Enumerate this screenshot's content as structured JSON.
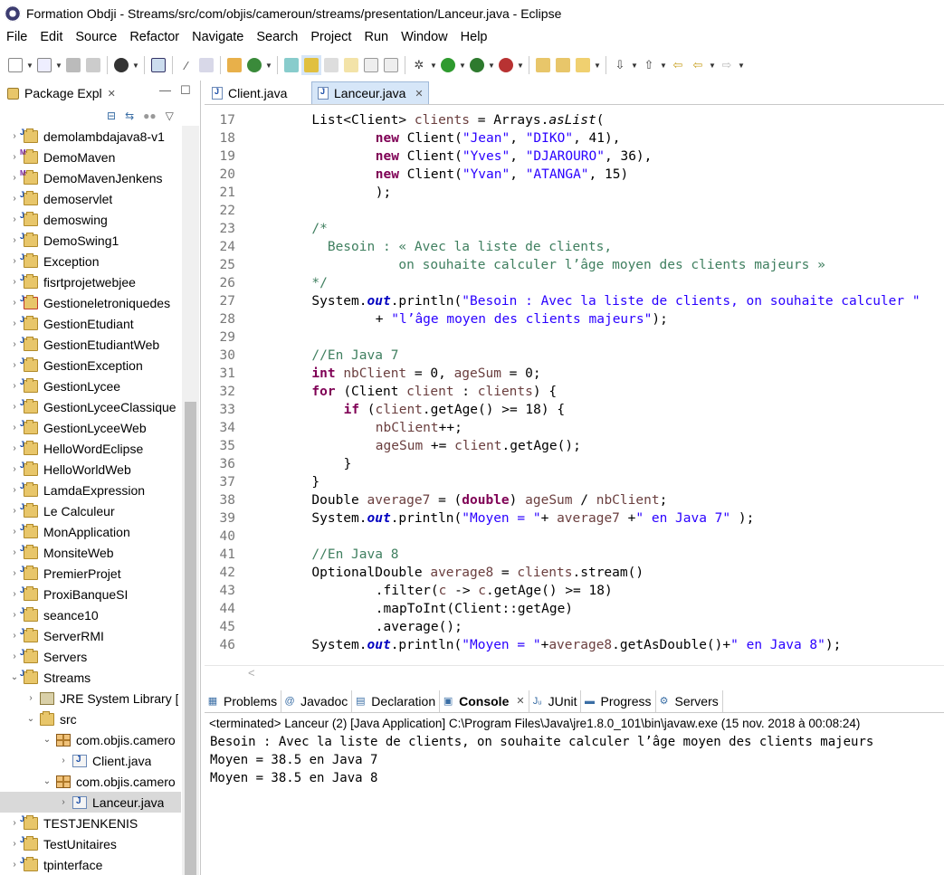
{
  "window": {
    "title": "Formation Obdji - Streams/src/com/objis/cameroun/streams/presentation/Lanceur.java - Eclipse"
  },
  "menu": [
    "File",
    "Edit",
    "Source",
    "Refactor",
    "Navigate",
    "Search",
    "Project",
    "Run",
    "Window",
    "Help"
  ],
  "toolbar_icons": [
    "new-icon",
    "save-icon",
    "print-icon",
    "debug-icon",
    "run-icon",
    "external-tools-icon",
    "search-icon",
    "back-icon",
    "forward-icon"
  ],
  "explorer": {
    "tab_label": "Package Expl",
    "items": [
      {
        "label": "demolambdajava8-v1",
        "twisty": ">",
        "icon": "project"
      },
      {
        "label": "DemoMaven",
        "twisty": ">",
        "icon": "maven"
      },
      {
        "label": "DemoMavenJenkens",
        "twisty": ">",
        "icon": "maven"
      },
      {
        "label": "demoservlet",
        "twisty": ">",
        "icon": "project"
      },
      {
        "label": "demoswing",
        "twisty": ">",
        "icon": "project"
      },
      {
        "label": "DemoSwing1",
        "twisty": ">",
        "icon": "project"
      },
      {
        "label": "Exception",
        "twisty": ">",
        "icon": "project"
      },
      {
        "label": "fisrtprojetwebjee",
        "twisty": ">",
        "icon": "project"
      },
      {
        "label": "Gestioneletroniquedes",
        "twisty": ">",
        "icon": "error"
      },
      {
        "label": "GestionEtudiant",
        "twisty": ">",
        "icon": "project"
      },
      {
        "label": "GestionEtudiantWeb",
        "twisty": ">",
        "icon": "project"
      },
      {
        "label": "GestionException",
        "twisty": ">",
        "icon": "project"
      },
      {
        "label": "GestionLycee",
        "twisty": ">",
        "icon": "project"
      },
      {
        "label": "GestionLyceeClassique",
        "twisty": ">",
        "icon": "project"
      },
      {
        "label": "GestionLyceeWeb",
        "twisty": ">",
        "icon": "project"
      },
      {
        "label": "HelloWordEclipse",
        "twisty": ">",
        "icon": "project"
      },
      {
        "label": "HelloWorldWeb",
        "twisty": ">",
        "icon": "project"
      },
      {
        "label": "LamdaExpression",
        "twisty": ">",
        "icon": "project"
      },
      {
        "label": "Le Calculeur",
        "twisty": ">",
        "icon": "project"
      },
      {
        "label": "MonApplication",
        "twisty": ">",
        "icon": "project"
      },
      {
        "label": "MonsiteWeb",
        "twisty": ">",
        "icon": "project"
      },
      {
        "label": "PremierProjet",
        "twisty": ">",
        "icon": "project"
      },
      {
        "label": "ProxiBanqueSI",
        "twisty": ">",
        "icon": "project"
      },
      {
        "label": "seance10",
        "twisty": ">",
        "icon": "project"
      },
      {
        "label": "ServerRMI",
        "twisty": ">",
        "icon": "project"
      },
      {
        "label": "Servers",
        "twisty": ">",
        "icon": "project"
      },
      {
        "label": "Streams",
        "twisty": "v",
        "icon": "project"
      },
      {
        "label": "JRE System Library [",
        "twisty": ">",
        "icon": "library",
        "indent": 1
      },
      {
        "label": "src",
        "twisty": "v",
        "icon": "src",
        "indent": 1
      },
      {
        "label": "com.objis.camero",
        "twisty": "v",
        "icon": "package",
        "indent": 2
      },
      {
        "label": "Client.java",
        "twisty": ">",
        "icon": "java",
        "indent": 3
      },
      {
        "label": "com.objis.camero",
        "twisty": "v",
        "icon": "package",
        "indent": 2
      },
      {
        "label": "Lanceur.java",
        "twisty": ">",
        "icon": "java",
        "indent": 3,
        "selected": true
      },
      {
        "label": "TESTJENKENIS",
        "twisty": ">",
        "icon": "project"
      },
      {
        "label": "TestUnitaires",
        "twisty": ">",
        "icon": "project"
      },
      {
        "label": "tpinterface",
        "twisty": ">",
        "icon": "project"
      }
    ]
  },
  "editor": {
    "tabs": [
      {
        "label": "Client.java",
        "active": false
      },
      {
        "label": "Lanceur.java",
        "active": true
      }
    ],
    "lines": [
      {
        "n": "17",
        "indent": 2,
        "html": "List&lt;Client&gt; <span class=\"var\">clients</span> = Arrays.<span class=\"it\">asList</span>("
      },
      {
        "n": "18",
        "indent": 4,
        "html": "<span class=\"kw\">new</span> Client(<span class=\"str\">\"Jean\"</span>, <span class=\"str\">\"DIKO\"</span>, 41),"
      },
      {
        "n": "19",
        "indent": 4,
        "html": "<span class=\"kw\">new</span> Client(<span class=\"str\">\"Yves\"</span>, <span class=\"str\">\"DJAROURO\"</span>, 36),"
      },
      {
        "n": "20",
        "indent": 4,
        "html": "<span class=\"kw\">new</span> Client(<span class=\"str\">\"Yvan\"</span>, <span class=\"str\">\"ATANGA\"</span>, 15)"
      },
      {
        "n": "21",
        "indent": 4,
        "html": ");"
      },
      {
        "n": "22",
        "indent": 0,
        "html": ""
      },
      {
        "n": "23",
        "indent": 2,
        "html": "<span class=\"cmt\">/*</span>"
      },
      {
        "n": "24",
        "indent": 2,
        "html": "<span class=\"cmt\">  Besoin : « Avec la liste de clients,</span>"
      },
      {
        "n": "25",
        "indent": 2,
        "html": "<span class=\"cmt\">           on souhaite calculer l’âge moyen des clients majeurs »</span>"
      },
      {
        "n": "26",
        "indent": 2,
        "html": "<span class=\"cmt\">*/</span>"
      },
      {
        "n": "27",
        "indent": 2,
        "html": "System.<span class=\"fld\">out</span>.println(<span class=\"str\">\"Besoin : Avec la liste de clients, on souhaite calculer \"</span>"
      },
      {
        "n": "28",
        "indent": 4,
        "html": "+ <span class=\"str\">\"l’âge moyen des clients majeurs\"</span>);"
      },
      {
        "n": "29",
        "indent": 0,
        "html": ""
      },
      {
        "n": "30",
        "indent": 2,
        "html": "<span class=\"cmt\">//En Java 7</span>"
      },
      {
        "n": "31",
        "indent": 2,
        "html": "<span class=\"kw\">int</span> <span class=\"var\">nbClient</span> = 0, <span class=\"var\">ageSum</span> = 0;"
      },
      {
        "n": "32",
        "indent": 2,
        "html": "<span class=\"kw\">for</span> (Client <span class=\"var\">client</span> : <span class=\"var\">clients</span>) {"
      },
      {
        "n": "33",
        "indent": 3,
        "html": "<span class=\"kw\">if</span> (<span class=\"var\">client</span>.getAge() &gt;= 18) {"
      },
      {
        "n": "34",
        "indent": 4,
        "html": "<span class=\"var\">nbClient</span>++;"
      },
      {
        "n": "35",
        "indent": 4,
        "html": "<span class=\"var\">ageSum</span> += <span class=\"var\">client</span>.getAge();"
      },
      {
        "n": "36",
        "indent": 3,
        "html": "}"
      },
      {
        "n": "37",
        "indent": 2,
        "html": "}"
      },
      {
        "n": "38",
        "indent": 2,
        "html": "Double <span class=\"var\">average7</span> = (<span class=\"kw\">double</span>) <span class=\"var\">ageSum</span> / <span class=\"var\">nbClient</span>;"
      },
      {
        "n": "39",
        "indent": 2,
        "html": "System.<span class=\"fld\">out</span>.println(<span class=\"str\">\"Moyen = \"</span>+ <span class=\"var\">average7</span> +<span class=\"str\">\" en Java 7\"</span> );"
      },
      {
        "n": "40",
        "indent": 0,
        "html": ""
      },
      {
        "n": "41",
        "indent": 2,
        "html": "<span class=\"cmt\">//En Java 8</span>"
      },
      {
        "n": "42",
        "indent": 2,
        "html": "OptionalDouble <span class=\"var\">average8</span> = <span class=\"var\">clients</span>.stream()"
      },
      {
        "n": "43",
        "indent": 4,
        "html": ".filter(<span class=\"var\">c</span> -&gt; <span class=\"var\">c</span>.getAge() &gt;= 18)"
      },
      {
        "n": "44",
        "indent": 4,
        "html": ".mapToInt(Client::getAge)"
      },
      {
        "n": "45",
        "indent": 4,
        "html": ".average();"
      },
      {
        "n": "46",
        "indent": 2,
        "html": "System.<span class=\"fld\">out</span>.println(<span class=\"str\">\"Moyen = \"</span>+<span class=\"var\">average8</span>.getAsDouble()+<span class=\"str\">\" en Java 8\"</span>);"
      }
    ]
  },
  "bottom": {
    "tabs": [
      {
        "label": "Problems",
        "icon": "problems-icon",
        "active": false
      },
      {
        "label": "Javadoc",
        "icon": "javadoc-icon",
        "active": false
      },
      {
        "label": "Declaration",
        "icon": "declaration-icon",
        "active": false
      },
      {
        "label": "Console",
        "icon": "console-icon",
        "active": true
      },
      {
        "label": "JUnit",
        "icon": "junit-icon",
        "active": false
      },
      {
        "label": "Progress",
        "icon": "progress-icon",
        "active": false
      },
      {
        "label": "Servers",
        "icon": "servers-icon",
        "active": false
      }
    ],
    "console_header": "<terminated> Lanceur (2) [Java Application] C:\\Program Files\\Java\\jre1.8.0_101\\bin\\javaw.exe (15 nov. 2018 à 00:08:24)",
    "console_lines": [
      "Besoin : Avec la liste de clients, on souhaite calculer l’âge moyen des clients majeurs",
      "Moyen = 38.5 en Java 7",
      "Moyen = 38.5 en Java 8"
    ]
  }
}
